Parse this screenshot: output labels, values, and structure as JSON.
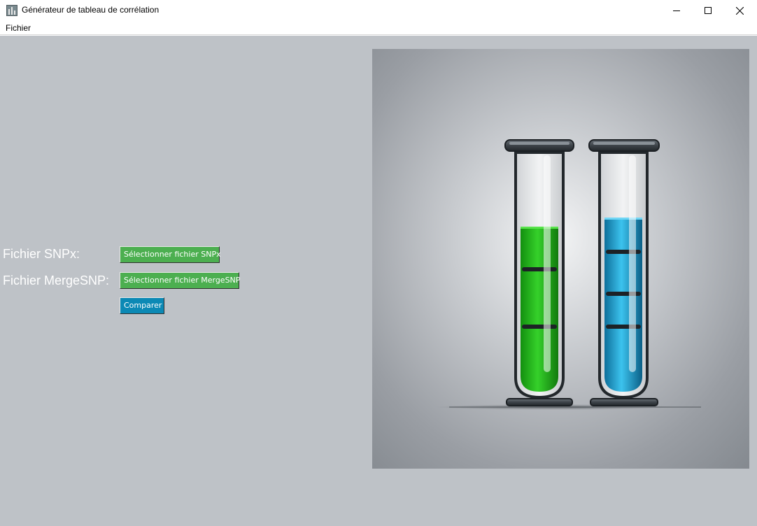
{
  "window": {
    "title": "Générateur de tableau de corrélation",
    "icon": "chart-app-icon",
    "controls": [
      "minimize",
      "maximize",
      "close"
    ]
  },
  "menubar": {
    "items": [
      {
        "label": "Fichier"
      }
    ]
  },
  "form": {
    "snpx_label": "Fichier SNPx:",
    "snpx_button": "Sélectionner fichier SNPx",
    "merge_label": "Fichier MergeSNP:",
    "merge_button": "Sélectionner fichier MergeSNP",
    "compare_button": "Comparer"
  },
  "illustration": {
    "subject": "two-test-tubes",
    "tube_colors": [
      "#23b51c",
      "#23a6d9"
    ]
  },
  "colors": {
    "background": "#bec2c7",
    "button_green": "#4caf50",
    "button_blue": "#0c89b5",
    "label_text": "#ffffff"
  }
}
